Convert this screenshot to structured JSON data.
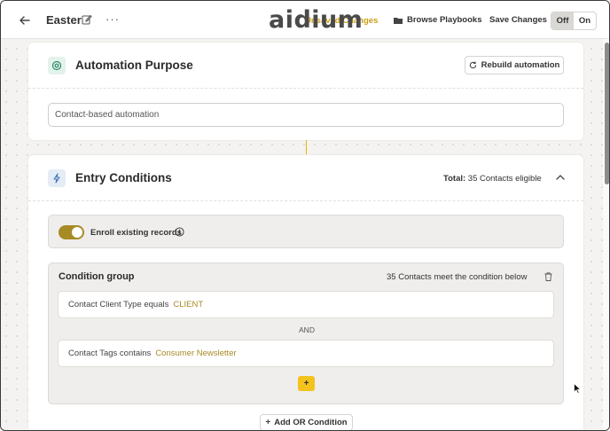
{
  "topbar": {
    "title": "Easter",
    "more": "···",
    "logo": "aidium",
    "unsaved": "Unsaved Changes",
    "browse_label": "Browse Playbooks",
    "save_label": "Save Changes",
    "toggle_off": "Off",
    "toggle_on": "On",
    "active_toggle": "Off"
  },
  "purpose": {
    "title": "Automation Purpose",
    "rebuild_label": "Rebuild automation",
    "input_value": "Contact-based automation"
  },
  "entry": {
    "title": "Entry Conditions",
    "total_label": "Total:",
    "total_value": "35 Contacts eligible",
    "enroll_label": "Enroll existing records",
    "enroll_enabled": true,
    "group": {
      "title": "Condition group",
      "count": "35 Contacts meet the condition below",
      "conditions": [
        {
          "text": "Contact Client Type equals",
          "value": "CLIENT"
        },
        {
          "text": "Contact Tags contains",
          "value": "Consumer Newsletter"
        }
      ],
      "joiner": "AND",
      "add_label": "+"
    },
    "add_or_label": "Add OR Condition"
  },
  "colors": {
    "accent": "#f3c21c",
    "value_text": "#a88a26",
    "unsaved": "#c59400"
  }
}
